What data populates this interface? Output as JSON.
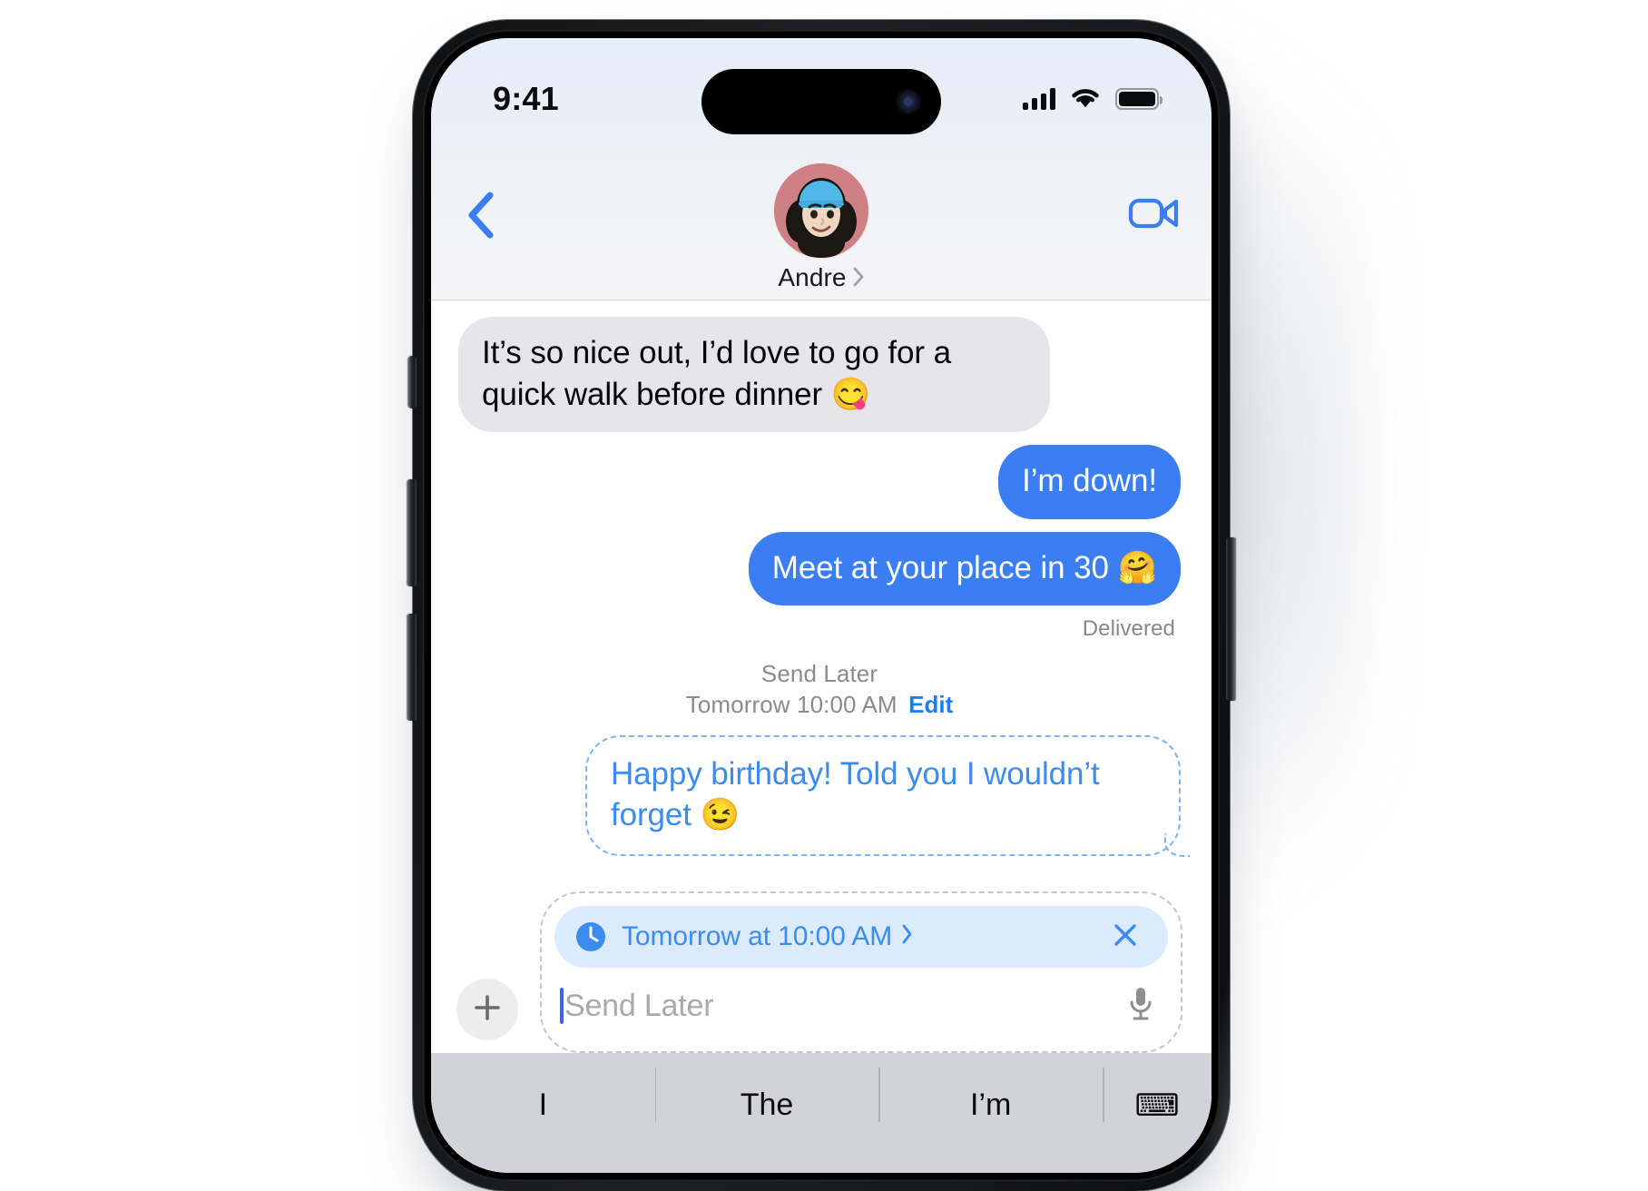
{
  "status_bar": {
    "time": "9:41",
    "signal_icon": "cellular-bars-icon",
    "wifi_icon": "wifi-icon",
    "battery_icon": "battery-icon"
  },
  "nav_bar": {
    "back_icon": "chevron-left-icon",
    "facetime_icon": "video-camera-icon",
    "contact_name": "Andre",
    "contact_chevron_icon": "chevron-right-icon",
    "avatar_icon": "memoji-avatar"
  },
  "conversation": {
    "messages": [
      {
        "id": "msg-incoming-1",
        "direction": "incoming",
        "text": "It’s so nice out, I’d love to go for a quick walk before dinner 😋",
        "tail": true
      },
      {
        "id": "msg-outgoing-1",
        "direction": "outgoing",
        "text": "I’m down!",
        "tail": false
      },
      {
        "id": "msg-outgoing-2",
        "direction": "outgoing",
        "text": "Meet at your place in 30 🤗",
        "tail": true
      }
    ],
    "delivery_status": "Delivered",
    "send_later": {
      "title": "Send Later",
      "time": "Tomorrow 10:00 AM",
      "edit_label": "Edit"
    },
    "scheduled_message": {
      "text": "Happy birthday! Told you I wouldn’t forget 😉"
    }
  },
  "composer": {
    "plus_icon": "plus-icon",
    "schedule_pill": {
      "clock_icon": "clock-icon",
      "label": "Tomorrow at 10:00 AM",
      "chevron": "›",
      "close_icon": "close-x-icon"
    },
    "input_placeholder": "Send Later",
    "input_value": "",
    "mic_icon": "microphone-icon"
  },
  "keyboard": {
    "predictions": [
      "I",
      "The",
      "I’m",
      "⌨"
    ]
  },
  "colors": {
    "imessage_blue": "#3b7ef4",
    "accent_blue": "#1d7df7",
    "incoming_bubble": "#e6e5ea",
    "scheduled_outline": "#7db2f3",
    "pill_background": "#dbeafd",
    "keyboard_background": "#d1d3d9"
  }
}
